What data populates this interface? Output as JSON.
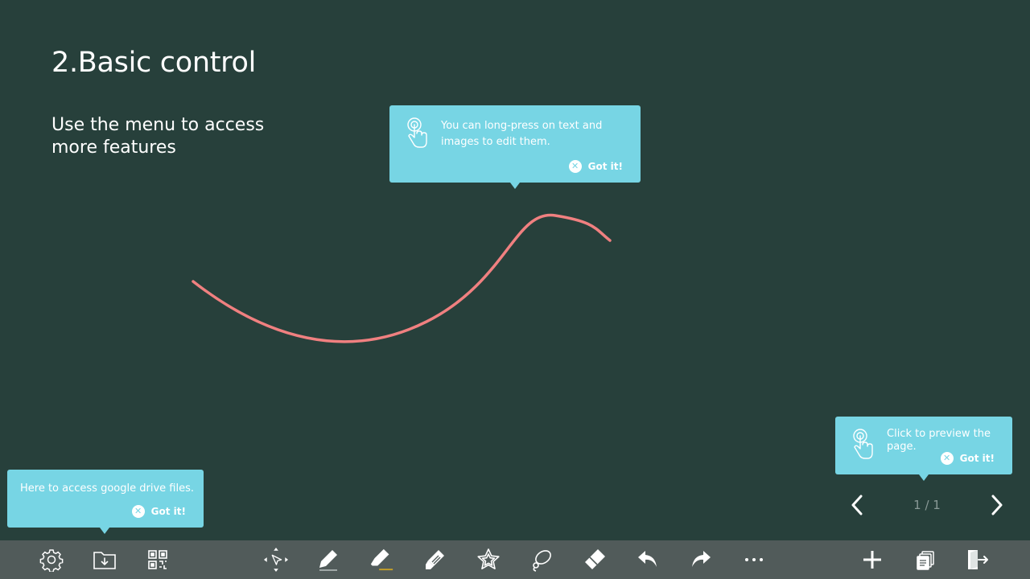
{
  "slide": {
    "title": "2.Basic control",
    "subtitle": "Use the menu to access more features",
    "stroke_color": "#f08080"
  },
  "tips": {
    "edit": {
      "message": "You can long-press on text and images to edit them.",
      "dismiss": "Got it!"
    },
    "preview": {
      "message": "Click to preview the page.",
      "dismiss": "Got it!"
    },
    "drive": {
      "message": "Here to access google drive files.",
      "dismiss": "Got it!"
    }
  },
  "pager": {
    "indicator": "1 / 1"
  },
  "toolbar": {
    "left": [
      "gear-icon",
      "folder-download-icon",
      "qr-code-icon"
    ],
    "center": [
      "select-move-icon",
      "pen-icon",
      "highlighter-icon",
      "marker-icon",
      "star-shape-icon",
      "lasso-icon",
      "eraser-icon",
      "undo-icon",
      "redo-icon",
      "more-icon"
    ],
    "right": [
      "add-page-icon",
      "pages-icon",
      "exit-icon"
    ]
  },
  "colors": {
    "background": "#27403b",
    "tooltip": "#77d5e4",
    "toolbar": "#515b5a",
    "highlight_accent": "#c9a227"
  }
}
